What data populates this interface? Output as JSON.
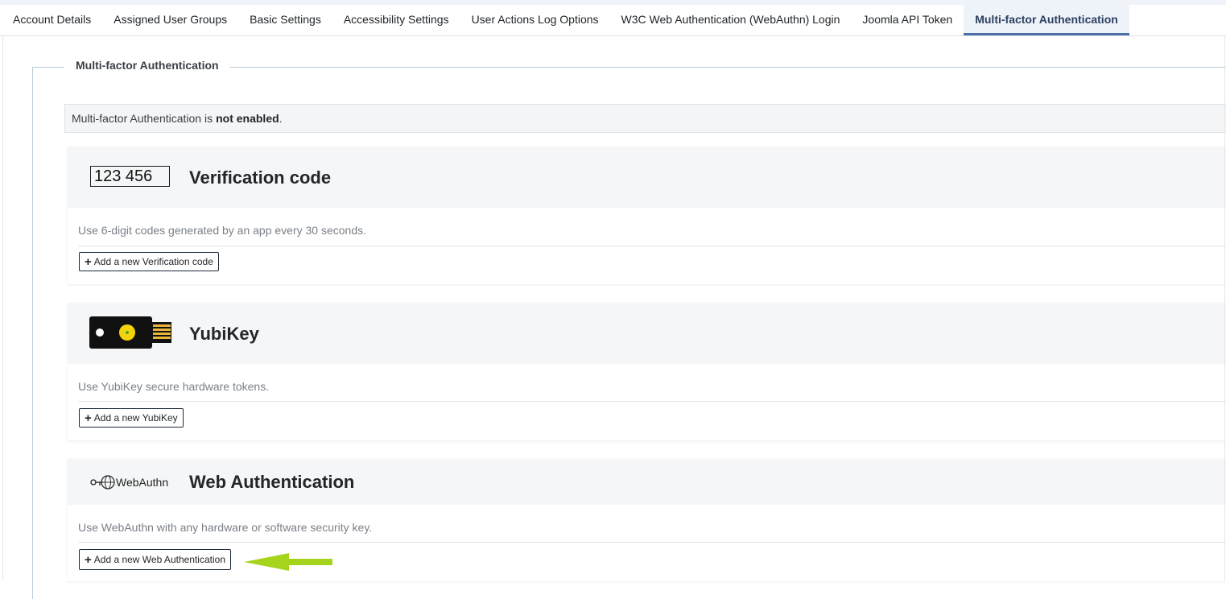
{
  "tabs": [
    {
      "label": "Account Details",
      "active": false
    },
    {
      "label": "Assigned User Groups",
      "active": false
    },
    {
      "label": "Basic Settings",
      "active": false
    },
    {
      "label": "Accessibility Settings",
      "active": false
    },
    {
      "label": "User Actions Log Options",
      "active": false
    },
    {
      "label": "W3C Web Authentication (WebAuthn) Login",
      "active": false
    },
    {
      "label": "Joomla API Token",
      "active": false
    },
    {
      "label": "Multi-factor Authentication",
      "active": true
    }
  ],
  "fieldset": {
    "legend": "Multi-factor Authentication"
  },
  "alert": {
    "prefix": "Multi-factor Authentication is",
    "status": "not enabled",
    "suffix": "."
  },
  "methods": [
    {
      "icon": "verification-code-icon",
      "icon_text": "123 456",
      "title": "Verification code",
      "description": "Use 6-digit codes generated by an app every 30 seconds.",
      "button_label": "Add a new Verification code"
    },
    {
      "icon": "yubikey-icon",
      "title": "YubiKey",
      "description": "Use YubiKey secure hardware tokens.",
      "button_label": "Add a new YubiKey"
    },
    {
      "icon": "webauthn-icon",
      "icon_text": "WebAuthn",
      "title": "Web Authentication",
      "description": "Use WebAuthn with any hardware or software security key.",
      "button_label": "Add a new Web Authentication"
    }
  ],
  "colors": {
    "active_tab_border": "#4a6ea5",
    "arrow": "#a6d41c"
  }
}
